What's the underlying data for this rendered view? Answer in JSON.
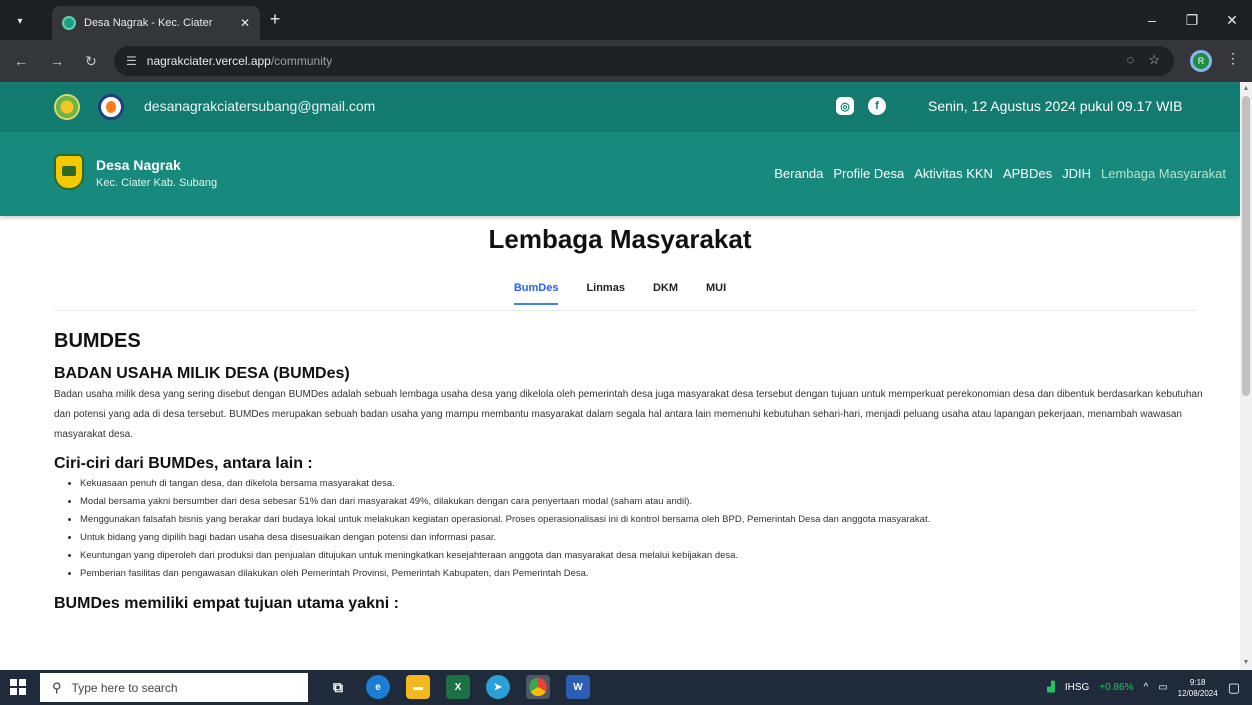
{
  "browser": {
    "tab_title": "Desa Nagrak - Kec. Ciater",
    "url_host": "nagrakciater.vercel.app",
    "url_path": "/community",
    "profile_initial": "R"
  },
  "topbar": {
    "email": "desanagrakciatersubang@gmail.com",
    "date": "Senin, 12 Agustus 2024 pukul 09.17 WIB"
  },
  "navbar": {
    "title": "Desa Nagrak",
    "subtitle": "Kec. Ciater Kab. Subang",
    "menu": [
      "Beranda",
      "Profile Desa",
      "Aktivitas KKN",
      "APBDes",
      "JDIH",
      "Lembaga Masyarakat"
    ]
  },
  "page": {
    "title": "Lembaga Masyarakat",
    "tabs": [
      "BumDes",
      "Linmas",
      "DKM",
      "MUI"
    ]
  },
  "content": {
    "heading": "BUMDES",
    "subheading1": "BADAN USAHA MILIK DESA (BUMDes)",
    "paragraph": "Badan usaha milik desa yang sering disebut dengan BUMDes adalah sebuah lembaga usaha desa yang dikelola oleh pemerintah desa juga masyarakat desa tersebut dengan tujuan untuk memperkuat perekonomian desa dan dibentuk berdasarkan kebutuhan dan potensi yang ada di desa tersebut. BUMDes merupakan sebuah badan usaha yang mampu membantu masyarakat dalam segala hal antara lain memenuhi kebutuhan sehari-hari, menjadi peluang usaha atau lapangan pekerjaan, menambah wawasan masyarakat desa.",
    "subheading2": "Ciri-ciri dari BUMDes, antara lain :",
    "bullets": [
      "Kekuasaan penuh di tangan desa, dan dikelola bersama masyarakat desa.",
      "Modal bersama yakni bersumber dari desa sebesar 51% dan dari masyarakat 49%, dilakukan dengan cara penyertaan modal (saham atau andil).",
      "Menggunakan falsafah bisnis yang berakar dari budaya lokal untuk melakukan kegiatan operasional. Proses operasionalisasi ini di kontrol bersama oleh BPD, Pemerintah Desa dan anggota masyarakat.",
      "Untuk bidang yang dipilih bagi badan usaha desa disesuaikan dengan potensi dan informasi pasar.",
      "Keuntungan yang diperoleh dari produksi dan penjualan ditujukan untuk meningkatkan kesejahteraan anggota dan masyarakat desa melalui kebijakan desa.",
      "Pemberian fasilitas dan pengawasan dilakukan oleh Pemerintah Provinsi, Pemerintah Kabupaten, dan Pemerintah Desa."
    ],
    "subheading3": "BUMDes memiliki empat tujuan utama yakni :"
  },
  "taskbar": {
    "search_placeholder": "Type here to search",
    "ihsg_label": "IHSG",
    "ihsg_value": "+0.86%",
    "time": "9:18",
    "date": "12/08/2024"
  }
}
